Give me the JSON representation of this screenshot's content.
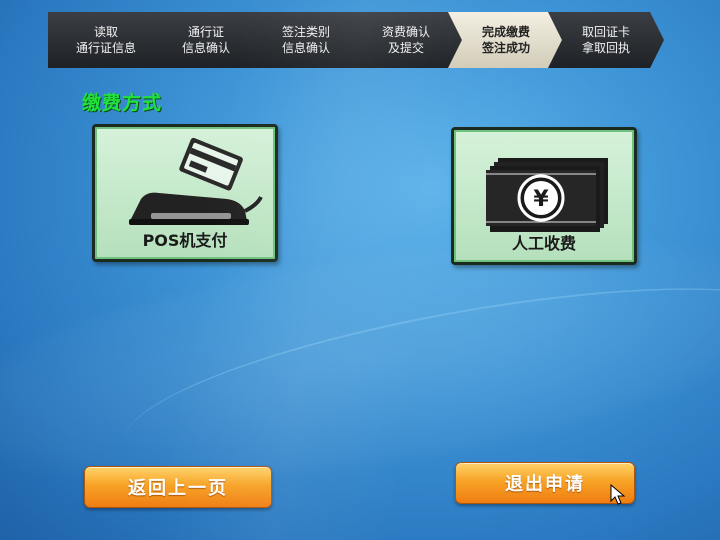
{
  "steps": [
    {
      "line1": "读取",
      "line2": "通行证信息",
      "active": false
    },
    {
      "line1": "通行证",
      "line2": "信息确认",
      "active": false
    },
    {
      "line1": "签注类别",
      "line2": "信息确认",
      "active": false
    },
    {
      "line1": "资费确认",
      "line2": "及提交",
      "active": false
    },
    {
      "line1": "完成缴费",
      "line2": "签注成功",
      "active": true
    },
    {
      "line1": "取回证卡",
      "line2": "拿取回执",
      "active": false
    }
  ],
  "section_title": "缴费方式",
  "payment_options": {
    "pos": {
      "label": "POS机支付",
      "icon": "pos-terminal-icon"
    },
    "manual": {
      "label": "人工收费",
      "icon": "cash-yuan-icon"
    }
  },
  "buttons": {
    "back": "返回上一页",
    "exit": "退出申请"
  },
  "colors": {
    "step_active": "#e9e4d2",
    "step_inactive": "#2b2e33",
    "section_title": "#22e23c",
    "card_bg": "#c8ecce",
    "button_orange": "#f7a326",
    "background_blue": "#3d94d6"
  }
}
